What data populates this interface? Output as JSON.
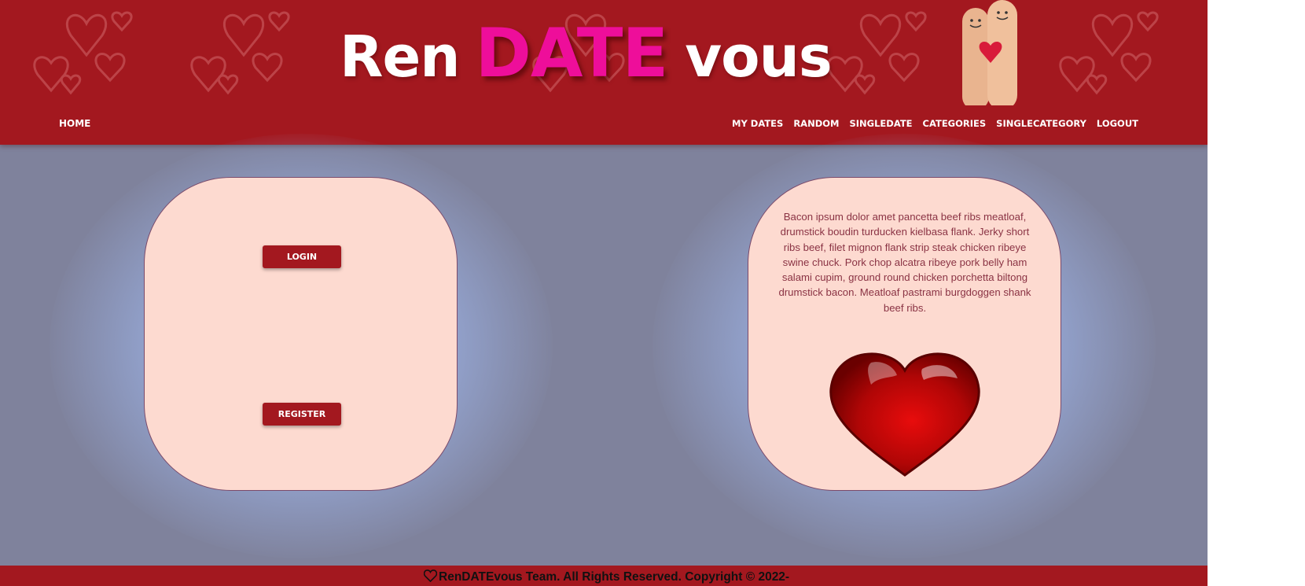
{
  "header": {
    "logo": {
      "part1": "Ren",
      "part2": "DATE",
      "part3": "vous"
    },
    "nav": {
      "home": "HOME",
      "right": [
        "MY DATES",
        "RANDOM",
        "SINGLEDATE",
        "CATEGORIES",
        "SINGLECATEGORY",
        "LOGOUT"
      ]
    },
    "decor_icons": [
      "hearts-pattern-icon",
      "finger-couple-image"
    ]
  },
  "main": {
    "left_card": {
      "login_label": "LOGIN",
      "register_label": "REGISTER"
    },
    "right_card": {
      "text": "Bacon ipsum dolor amet pancetta beef ribs meatloaf, drumstick boudin turducken kielbasa flank. Jerky short ribs beef, filet mignon flank strip steak chicken ribeye swine chuck. Pork chop alcatra ribeye pork belly ham salami cupim, ground round chicken porchetta biltong drumstick bacon. Meatloaf pastrami burgdoggen shank beef ribs.",
      "image_icon": "red-heart-image"
    }
  },
  "footer": {
    "icon": "heart-outline-icon",
    "text": "RenDATEvous Team. All Rights Reserved. Copyright © 2022-"
  },
  "colors": {
    "brand_red": "#a3181f",
    "logo_pink": "#ee0e9a",
    "page_bg": "#7f829c",
    "card_bg": "#fddad0",
    "card_text": "#8a3344"
  }
}
